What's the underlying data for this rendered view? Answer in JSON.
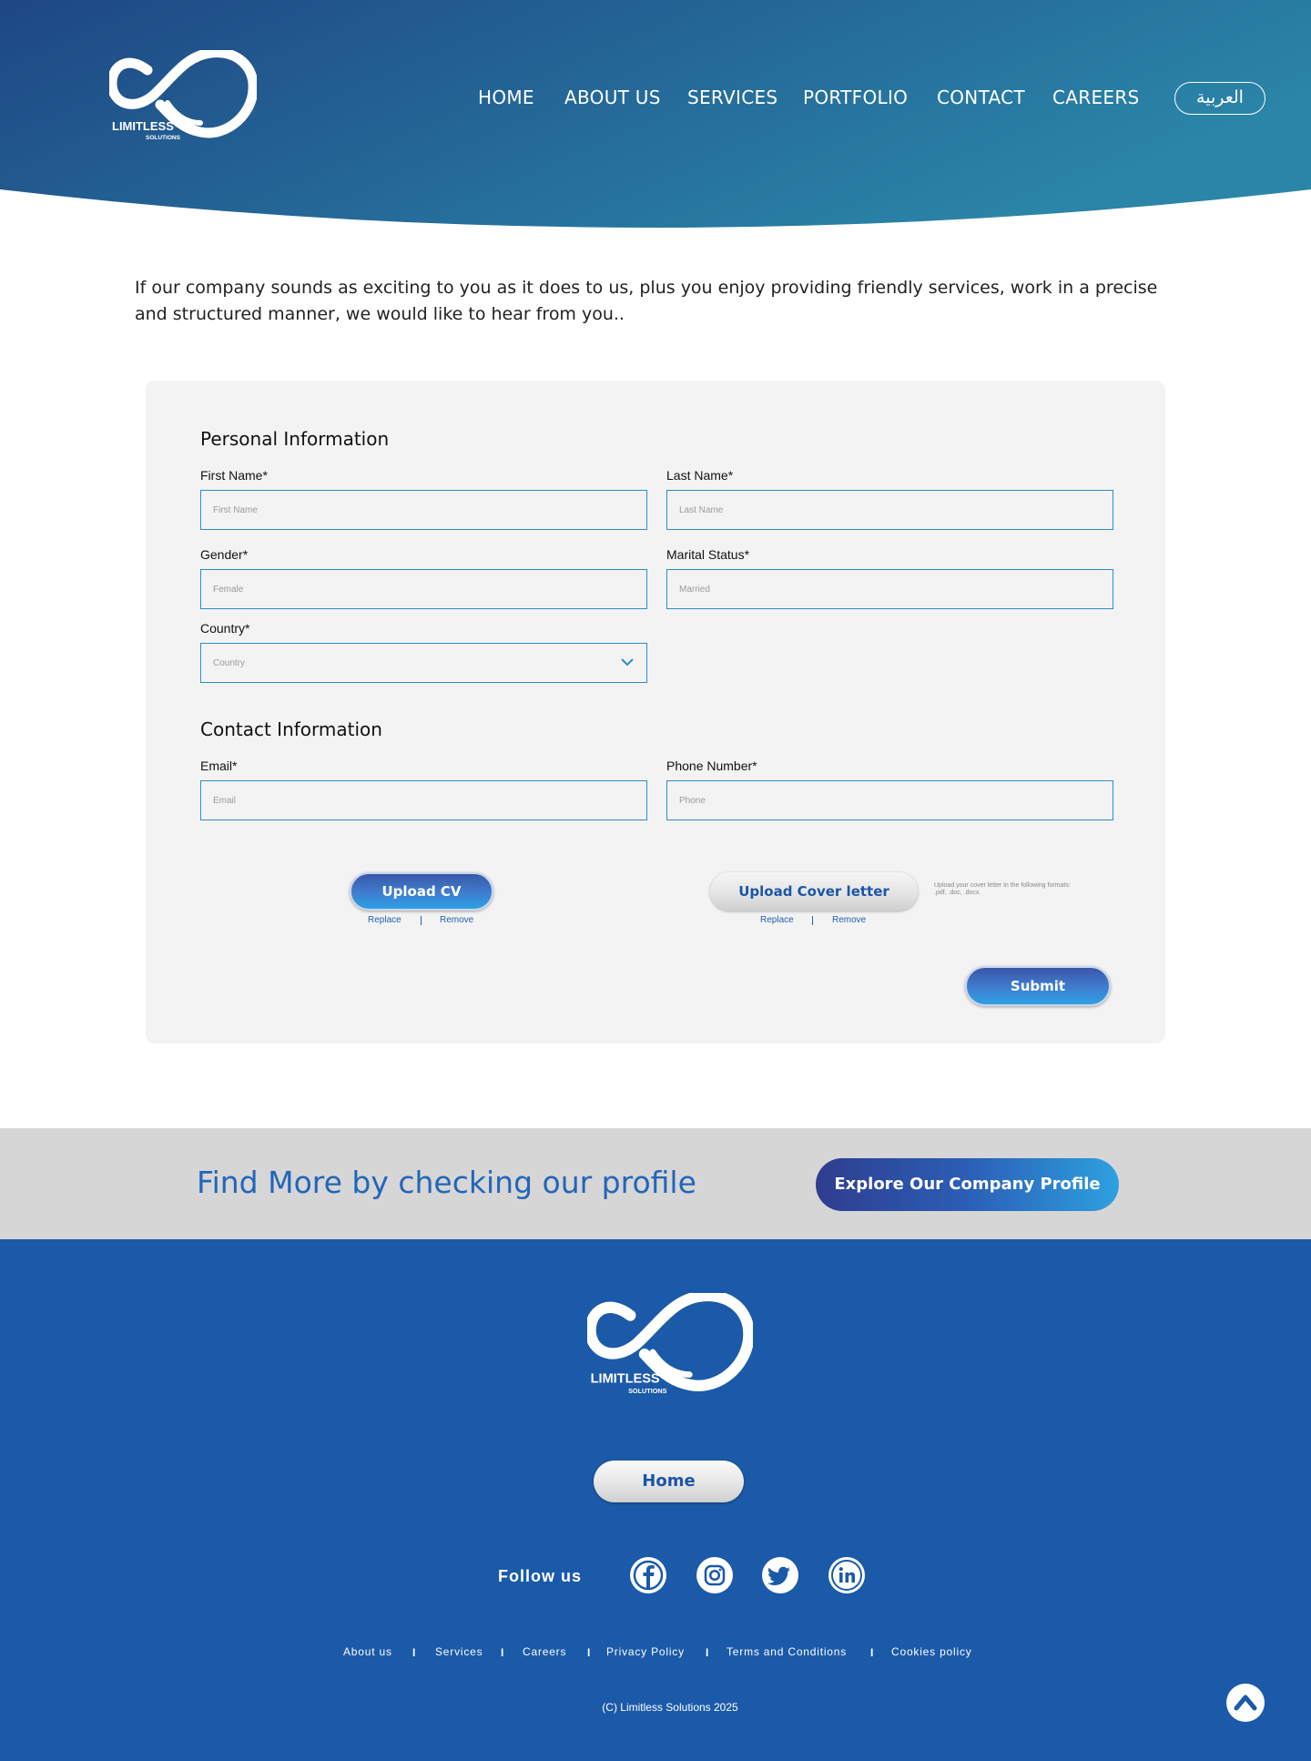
{
  "header": {
    "logo": {
      "word": "LIMITLESS",
      "sub": "SOLUTIONS"
    },
    "nav": [
      "HOME",
      "ABOUT US",
      "SERVICES",
      "PORTFOLIO",
      "CONTACT",
      "CAREERS"
    ],
    "language_button": "العربية"
  },
  "intro_text": "If our company sounds as exciting to you as it does to us, plus you enjoy providing friendly services, work in a precise and structured manner, we would like to hear from you..",
  "form": {
    "personal_title": "Personal Information",
    "first_name": {
      "label": "First Name*",
      "placeholder": "First Name"
    },
    "last_name": {
      "label": "Last Name*",
      "placeholder": "Last Name"
    },
    "gender": {
      "label": "Gender*",
      "placeholder": "Female"
    },
    "marital_status": {
      "label": "Marital Status*",
      "placeholder": "Married"
    },
    "country": {
      "label": "Country*",
      "placeholder": "Country"
    },
    "contact_title": "Contact Information",
    "email": {
      "label": "Email*",
      "placeholder": "Email"
    },
    "phone": {
      "label": "Phone Number*",
      "placeholder": "Phone"
    },
    "upload_cv": {
      "label": "Upload CV",
      "replace": "Replace",
      "remove": "Remove"
    },
    "upload_cover": {
      "label": "Upload Cover letter",
      "replace": "Replace",
      "remove": "Remove",
      "note": "Upload your cover letter in the following formats: .pdf, .doc, .docx."
    },
    "submit": "Submit"
  },
  "banner": {
    "text": "Find More by checking our profile",
    "button": "Explore Our Company Profile"
  },
  "footer": {
    "logo": {
      "word": "LIMITLESS",
      "sub": "SOLUTIONS"
    },
    "home_button": "Home",
    "follow": "Follow us",
    "social": [
      "facebook-icon",
      "instagram-icon",
      "twitter-icon",
      "linkedin-icon"
    ],
    "links": [
      "About us",
      "Services",
      "Careers",
      "Privacy Policy",
      "Terms and Conditions",
      "Cookies policy"
    ],
    "separator": "I",
    "copyright": "(C) Limitless Solutions 2025"
  },
  "colors": {
    "header_gradient_start": "#1e4784",
    "header_gradient_end": "#2a85a8",
    "field_border": "#2a8fc6",
    "footer_bg": "#1b5aa8",
    "banner_bg": "#d6d6d6",
    "accent_text": "#2266b8"
  }
}
